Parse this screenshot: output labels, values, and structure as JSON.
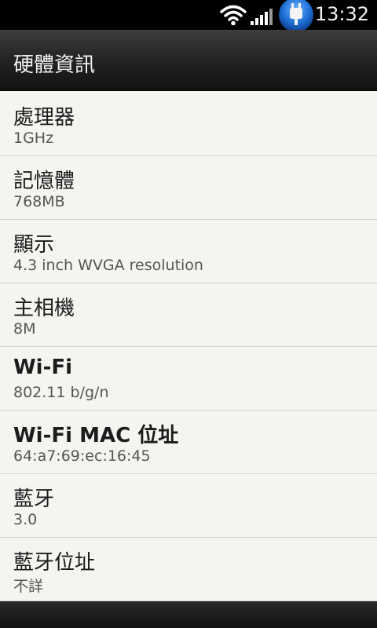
{
  "status_bar": {
    "time": "13:32",
    "icons": [
      "wifi-icon",
      "signal-icon",
      "plug-icon"
    ]
  },
  "title_bar": {
    "title": "硬體資訊"
  },
  "items": [
    {
      "label": "處理器",
      "value": "1GHz"
    },
    {
      "label": "記憶體",
      "value": "768MB"
    },
    {
      "label": "顯示",
      "value": "4.3 inch WVGA resolution"
    },
    {
      "label": "主相機",
      "value": "8M"
    },
    {
      "label": "Wi-Fi",
      "value": "802.11 b/g/n"
    },
    {
      "label": "Wi-Fi MAC 位址",
      "value": "64:a7:69:ec:16:45"
    },
    {
      "label": "藍牙",
      "value": "3.0"
    },
    {
      "label": "藍牙位址",
      "value": "不詳"
    }
  ],
  "colors": {
    "background": "#f4f4f1",
    "title_bar": "#262626",
    "status_bar": "#000000",
    "divider": "#d3d3cf",
    "accent_blue": "#1f6fd6"
  }
}
